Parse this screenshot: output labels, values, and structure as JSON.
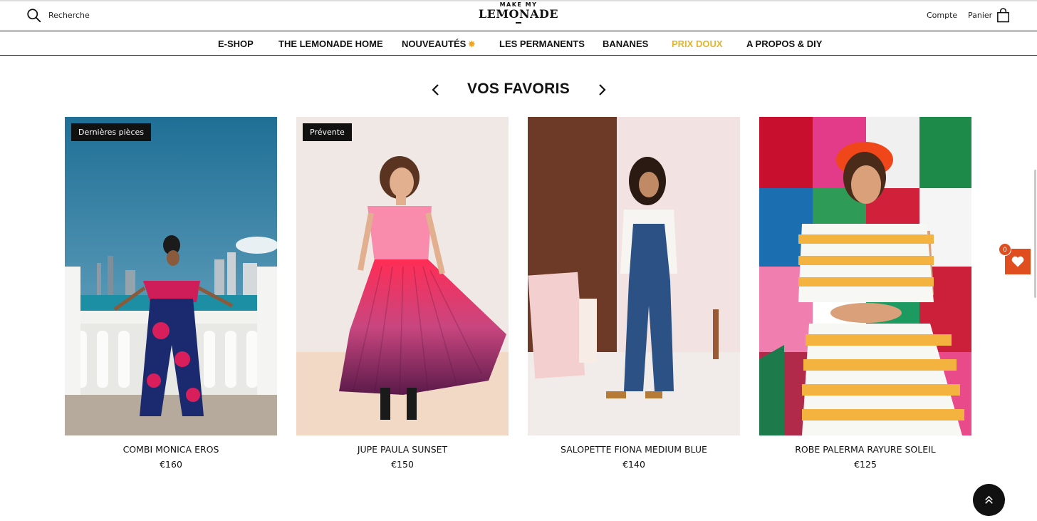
{
  "header": {
    "search_label": "Recherche",
    "logo_small": "MAKE MY",
    "logo_big": "LEMONADE",
    "account_label": "Compte",
    "cart_label": "Panier"
  },
  "nav": {
    "items": [
      {
        "label": "E-SHOP"
      },
      {
        "label": "THE LEMONADE HOME"
      },
      {
        "label": "NOUVEAUTÉS"
      },
      {
        "label": "LES PERMANENTS"
      },
      {
        "label": "BANANES"
      },
      {
        "label": "PRIX DOUX"
      },
      {
        "label": "A PROPOS & DIY"
      }
    ],
    "accent_color": "#e3b42e"
  },
  "section": {
    "title": "VOS FAVORIS"
  },
  "products": [
    {
      "name": "COMBI MONICA EROS",
      "price": "€160",
      "badge": "Dernières pièces"
    },
    {
      "name": "JUPE PAULA SUNSET",
      "price": "€150",
      "badge": "Prévente"
    },
    {
      "name": "SALOPETTE FIONA MEDIUM BLUE",
      "price": "€140",
      "badge": ""
    },
    {
      "name": "ROBE PALERMA RAYURE SOLEIL",
      "price": "€125",
      "badge": ""
    }
  ],
  "wishlist": {
    "count": "0",
    "color": "#e04d1f"
  }
}
